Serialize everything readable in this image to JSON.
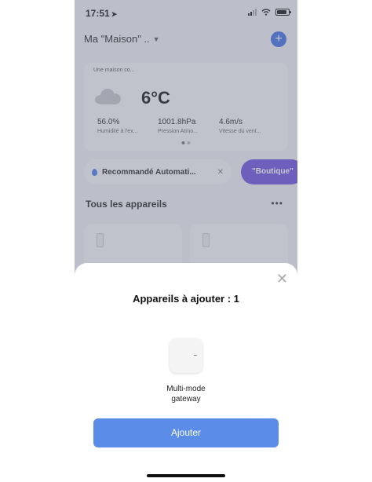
{
  "status_bar": {
    "time": "17:51",
    "location_glyph": "➤"
  },
  "header": {
    "home_name": "Ma \"Maison\" ..",
    "caret": "▼",
    "add_glyph": "+"
  },
  "weather": {
    "location": "Une maison co...",
    "temperature": "6°C",
    "stats": [
      {
        "value": "56.0%",
        "label": "Humidité à l'ex..."
      },
      {
        "value": "1001.8hPa",
        "label": "Pression Atmo..."
      },
      {
        "value": "4.6m/s",
        "label": "Vitesse du vent..."
      }
    ]
  },
  "chips": {
    "recommended": "Recommandé Automati...",
    "close_glyph": "✕",
    "shop": "\"Boutique\""
  },
  "devices_section": {
    "title": "Tous les appareils",
    "more_glyph": "•••"
  },
  "sheet": {
    "close_glyph": "✕",
    "title": "Appareils à ajouter : 1",
    "device_name_line1": "Multi-mode",
    "device_name_line2": "gateway",
    "confirm_label": "Ajouter"
  },
  "icons": [
    "location-arrow-icon",
    "signal-icon",
    "wifi-icon",
    "battery-icon",
    "chevron-down-icon",
    "plus-icon",
    "cloud-icon",
    "water-drop-icon",
    "close-icon",
    "more-icon",
    "sensor-icon",
    "gateway-icon"
  ],
  "colors": {
    "accent_blue": "#3b6fe0",
    "button_blue": "#5b8ce8",
    "shop_purple": "#6a4fdc",
    "dim_overlay": "rgba(115,120,140,0.42)"
  }
}
